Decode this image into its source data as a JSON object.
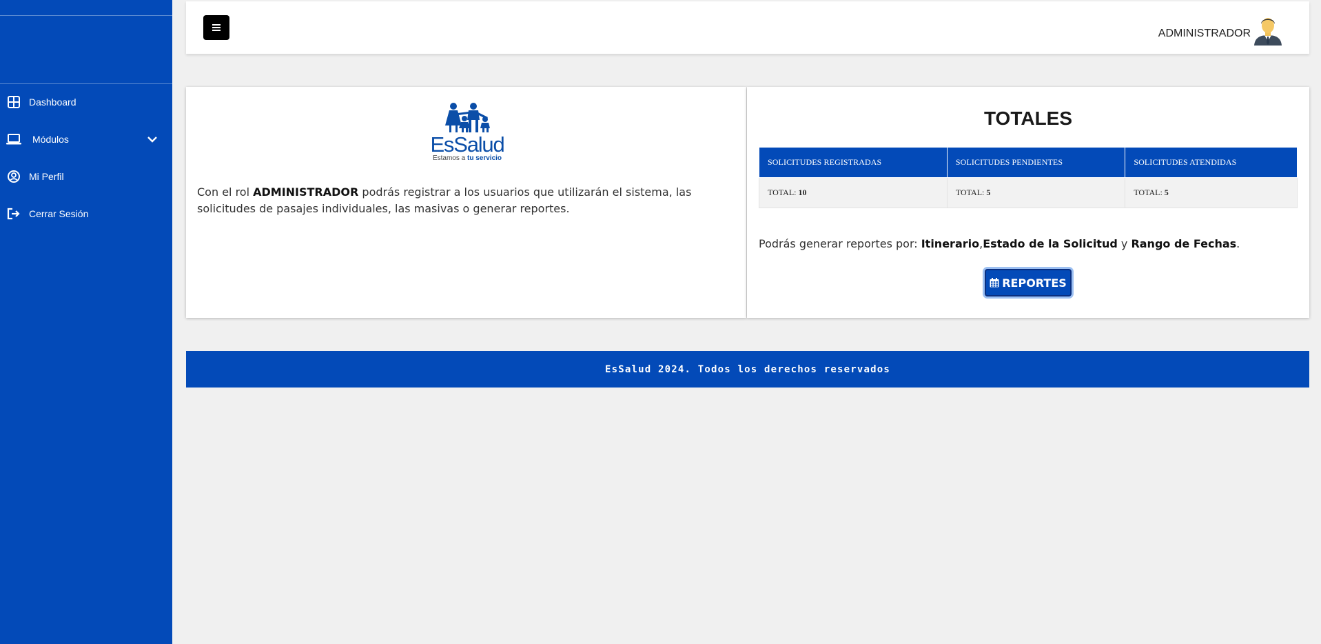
{
  "sidebar": {
    "items": [
      {
        "label": "Dashboard",
        "icon": "grid-icon"
      },
      {
        "label": "Módulos",
        "icon": "laptop-icon"
      },
      {
        "label": "Mi Perfil",
        "icon": "user-circle-icon"
      },
      {
        "label": "Cerrar Sesión",
        "icon": "logout-icon"
      }
    ]
  },
  "header": {
    "menu_icon": "hamburger-icon",
    "user_name": "ADMINISTRADOR",
    "avatar_icon": "user-avatar-icon"
  },
  "intro": {
    "logo": {
      "name": "EsSalud",
      "tagline_prefix": "Estamos a ",
      "tagline_strong": "tu servicio"
    },
    "text_before": "Con el rol ",
    "role": "ADMINISTRADOR",
    "text_after": " podrás registrar a los usuarios que utilizarán el sistema, las solicitudes de pasajes individuales, las masivas o generar reportes."
  },
  "totals": {
    "title": "TOTALES",
    "columns": [
      "SOLICITUDES REGISTRADAS",
      "SOLICITUDES PENDIENTES",
      "SOLICITUDES ATENDIDAS"
    ],
    "value_prefix": "TOTAL: ",
    "values": [
      "10",
      "5",
      "5"
    ]
  },
  "reports": {
    "text_prefix": "Podrás generar reportes por: ",
    "criteria_1": "Itinerario",
    "sep_1": ",",
    "criteria_2": "Estado de la Solicitud",
    "sep_2": " y ",
    "criteria_3": "Rango de Fechas",
    "text_end": ".",
    "button_label": "REPORTES",
    "button_icon": "calendar-icon"
  },
  "footer": {
    "text": "EsSalud 2024. Todos los derechos reservados"
  },
  "colors": {
    "brand_blue": "#034ab8",
    "background": "#f0f0f0"
  }
}
